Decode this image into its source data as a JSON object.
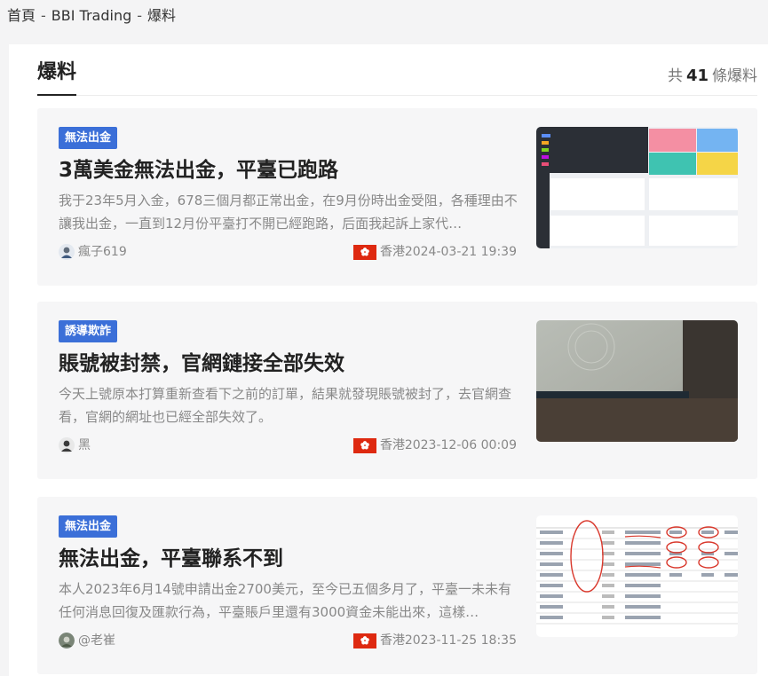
{
  "breadcrumb": [
    "首頁",
    "BBI Trading",
    "爆料"
  ],
  "breadcrumb_sep": "-",
  "section": {
    "title": "爆料",
    "count_prefix": "共",
    "count": "41",
    "count_suffix": "條爆料"
  },
  "colors": {
    "tag": "#3b6fd8",
    "flag": "#de2910",
    "text": "#222222",
    "muted": "#888888",
    "card_bg": "#f6f6f7"
  },
  "cards": [
    {
      "tag": "無法出金",
      "title": "3萬美金無法出金，平臺已跑路",
      "excerpt": "我于23年5月入金，678三個月都正常出金，在9月份時出金受阻，各種理由不讓我出金，一直到12月份平臺打不開已經跑路，后面我起訴上家代…",
      "author": "瘋子619",
      "author_icon": "user-avatar-icon",
      "location": "香港",
      "location_icon": "hong-kong-flag-icon",
      "date": "2024-03-21 19:39"
    },
    {
      "tag": "誘導欺詐",
      "title": "賬號被封禁，官網鏈接全部失效",
      "excerpt": "今天上號原本打算重新查看下之前的訂單，結果就發現賬號被封了，去官網查看，官網的網址也已經全部失效了。",
      "author": "黑",
      "author_icon": "user-avatar-icon",
      "location": "香港",
      "location_icon": "hong-kong-flag-icon",
      "date": "2023-12-06 00:09"
    },
    {
      "tag": "無法出金",
      "title": "無法出金，平臺聯系不到",
      "excerpt": "本人2023年6月14號申請出金2700美元，至今已五個多月了，平臺一未未有任何消息回復及匯款行為，平臺賬戶里還有3000資金未能出來，這樣…",
      "author": "@老崔",
      "author_icon": "user-avatar-icon",
      "location": "香港",
      "location_icon": "hong-kong-flag-icon",
      "date": "2023-11-25 18:35"
    }
  ]
}
